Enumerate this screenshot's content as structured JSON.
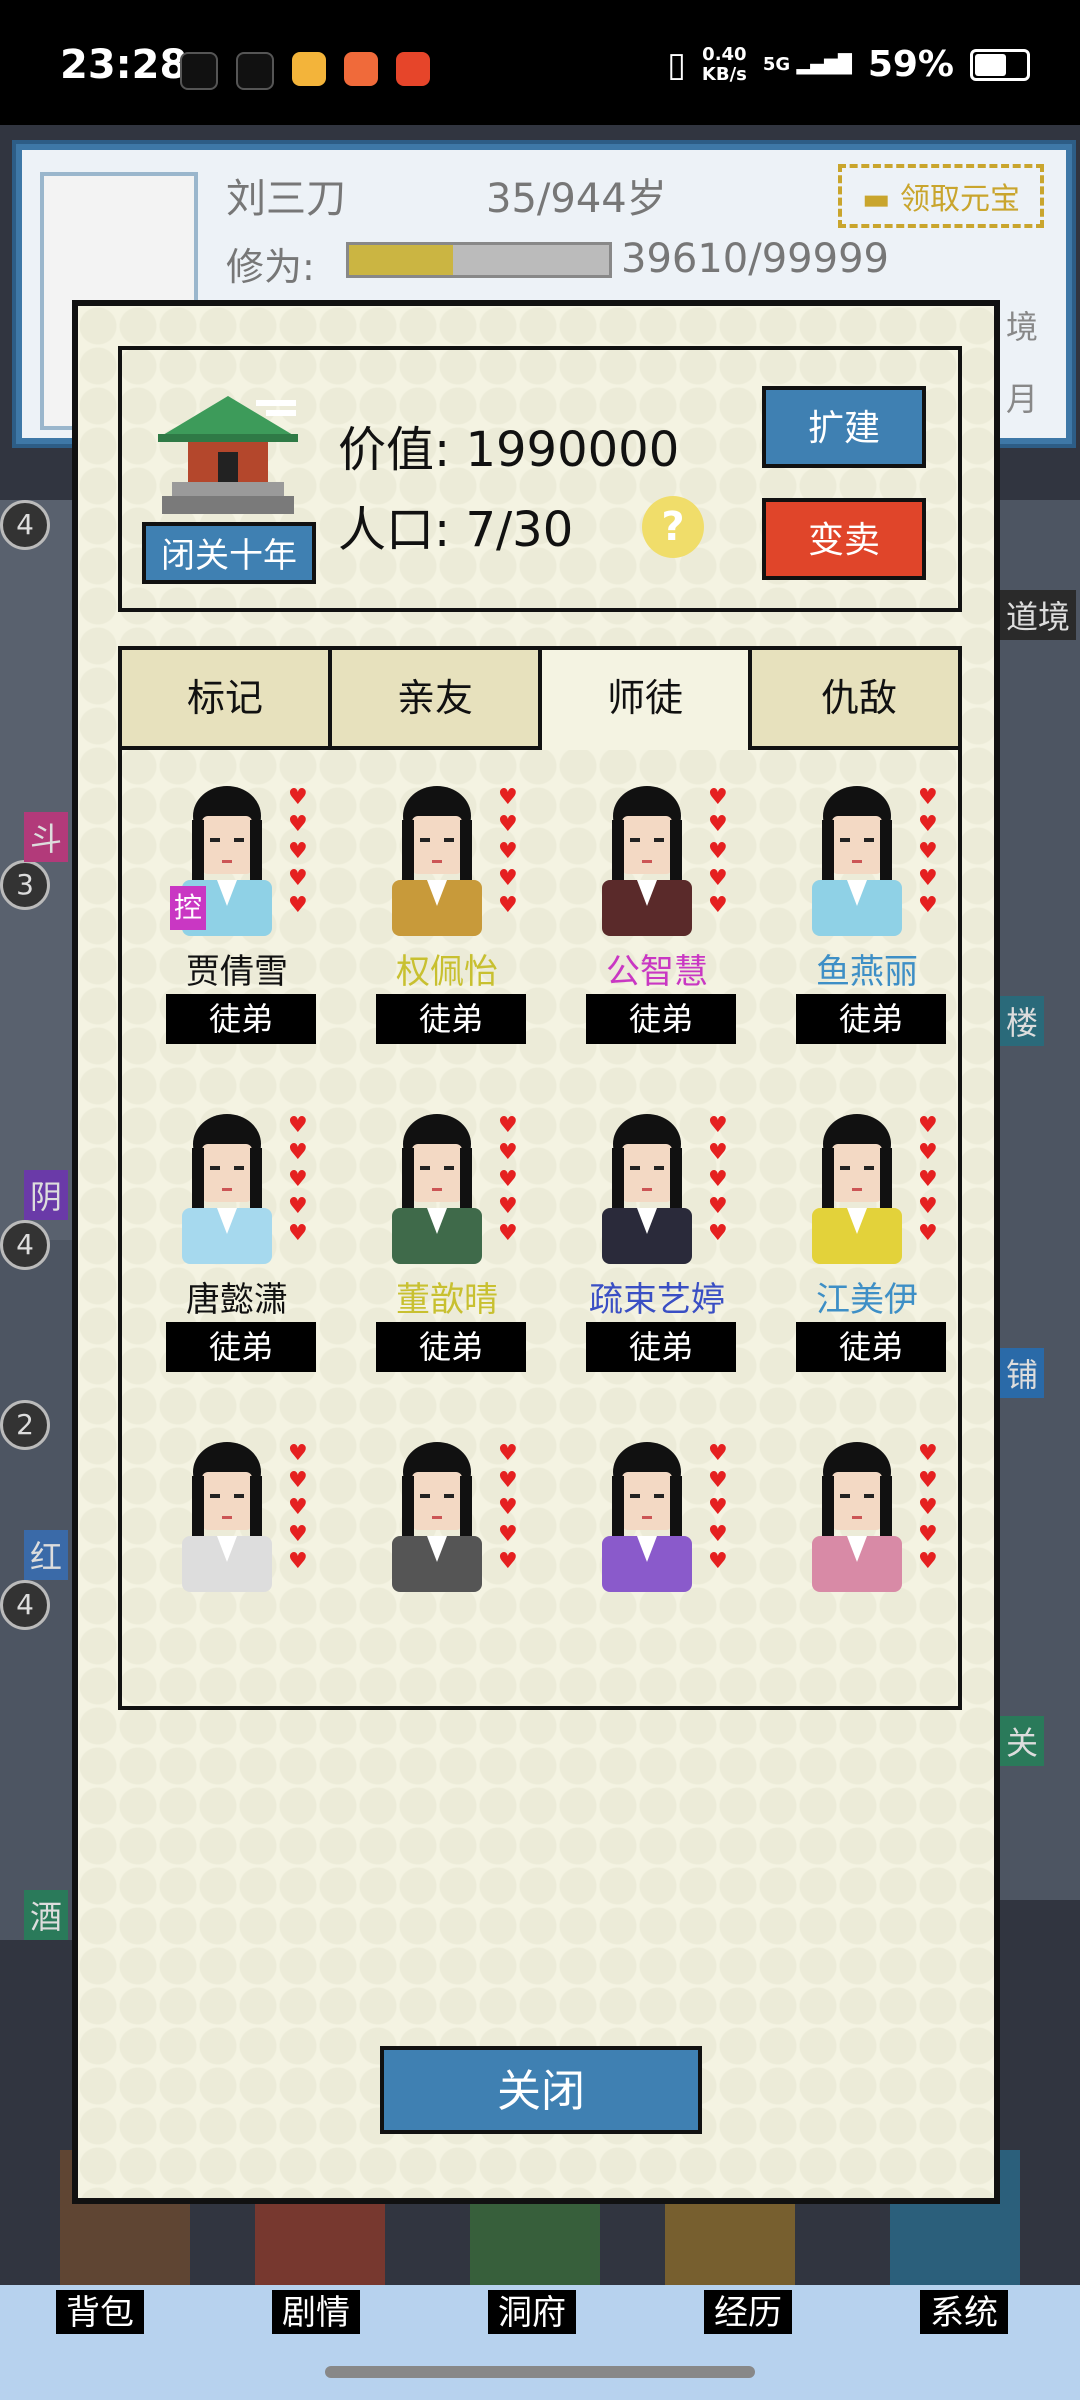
{
  "status_bar": {
    "time": "23:28",
    "net_speed_top": "0.40",
    "net_speed_unit": "KB/s",
    "signal": "5G",
    "battery": "59%"
  },
  "player": {
    "name": "刘三刀",
    "age": "35/944岁",
    "ingot_button": "领取元宝",
    "cultivation_label": "修为:",
    "cultivation_value": "39610/99999",
    "cultivation_progress": 0.4
  },
  "side_badges": [
    "4",
    "3",
    "4",
    "2",
    "4"
  ],
  "side_labels": [
    "斗",
    "阴",
    "红",
    "酒",
    "道境",
    "楼",
    "铺",
    "关",
    "境",
    "月"
  ],
  "residence": {
    "seclude_button": "闭关十年",
    "value_label": "价值:",
    "value": "1990000",
    "population_label": "人口:",
    "population": "7/30",
    "help_icon": "?",
    "expand_button": "扩建",
    "sell_button": "变卖"
  },
  "tabs": [
    {
      "label": "标记",
      "active": false
    },
    {
      "label": "亲友",
      "active": false
    },
    {
      "label": "师徒",
      "active": true
    },
    {
      "label": "仇敌",
      "active": false
    }
  ],
  "members": [
    {
      "name": "贾倩雪",
      "role": "徒弟",
      "name_color": "#111111",
      "controlled": true,
      "control_tag": "控",
      "hearts": 5
    },
    {
      "name": "权佩怡",
      "role": "徒弟",
      "name_color": "#c8c030",
      "controlled": false,
      "hearts": 5
    },
    {
      "name": "公智慧",
      "role": "徒弟",
      "name_color": "#c937c3",
      "controlled": false,
      "hearts": 5
    },
    {
      "name": "鱼燕丽",
      "role": "徒弟",
      "name_color": "#3e8fc6",
      "controlled": false,
      "hearts": 5
    },
    {
      "name": "唐懿潇",
      "role": "徒弟",
      "name_color": "#111111",
      "controlled": false,
      "hearts": 5
    },
    {
      "name": "董歆晴",
      "role": "徒弟",
      "name_color": "#c8c030",
      "controlled": false,
      "hearts": 5
    },
    {
      "name": "疏束艺婷",
      "role": "徒弟",
      "name_color": "#3a4fc4",
      "controlled": false,
      "hearts": 5
    },
    {
      "name": "江美伊",
      "role": "徒弟",
      "name_color": "#3e8fc6",
      "controlled": false,
      "hearts": 5
    },
    {
      "name": "",
      "role": "",
      "name_color": "#2fb52f",
      "controlled": false,
      "hearts": 5
    },
    {
      "name": "",
      "role": "",
      "name_color": "#c8c030",
      "controlled": false,
      "hearts": 5
    },
    {
      "name": "",
      "role": "",
      "name_color": "#c8c030",
      "controlled": false,
      "hearts": 5
    },
    {
      "name": "",
      "role": "",
      "name_color": "#c8c030",
      "controlled": false,
      "hearts": 5
    }
  ],
  "close_button": "关闭",
  "bottom_nav": [
    "背包",
    "剧情",
    "洞府",
    "经历",
    "系统"
  ],
  "colors": {
    "accent_blue": "#3f80b2",
    "sell_red": "#e0452a",
    "panel_bg": "#f4f3e2",
    "tab_bg": "#e7e1bd",
    "heart": "#e52020"
  }
}
